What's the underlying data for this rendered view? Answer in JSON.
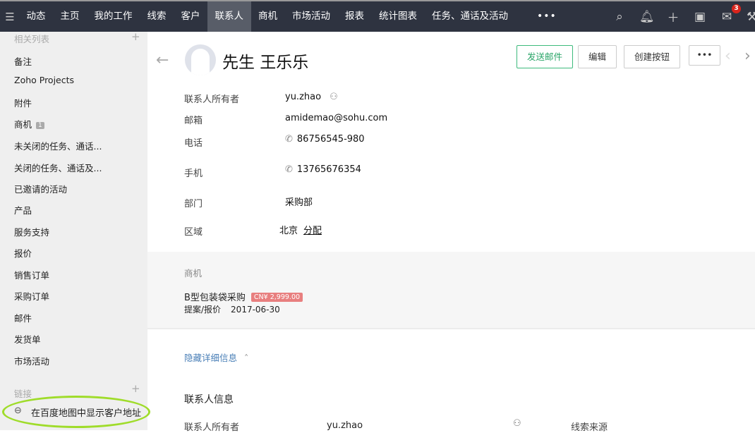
{
  "nav": {
    "items": [
      "动态",
      "主页",
      "我的工作",
      "线索",
      "客户",
      "联系人",
      "商机",
      "市场活动",
      "报表",
      "统计图表",
      "任务、通话及活动"
    ],
    "active": "联系人",
    "more": "•••",
    "mail_badge": "3"
  },
  "sidebar": {
    "related_header": "相关列表",
    "items": [
      "备注",
      "Zoho Projects",
      "附件",
      "商机",
      "未关闭的任务、通话...",
      "关闭的任务、通话及...",
      "已邀请的活动",
      "产品",
      "服务支持",
      "报价",
      "销售订单",
      "采购订单",
      "邮件",
      "发货单",
      "市场活动"
    ],
    "deal_count": "1",
    "links_header": "链接",
    "map_link": "在百度地图中显示客户地址"
  },
  "record": {
    "title": "先生 王乐乐",
    "buttons": {
      "send_email": "发送邮件",
      "edit": "编辑",
      "create_button": "创建按钮",
      "more": "•••"
    },
    "fields": [
      {
        "label": "联系人所有者",
        "value": "yu.zhao"
      },
      {
        "label": "邮箱",
        "value": "amidemao@sohu.com"
      },
      {
        "label": "电话",
        "value": "86756545-980"
      },
      {
        "label": "手机",
        "value": "13765676354"
      },
      {
        "label": "部门",
        "value": "采购部"
      },
      {
        "label": "区域",
        "value": "北京",
        "action": "分配"
      }
    ]
  },
  "deals": {
    "header": "商机",
    "name": "B型包装袋采购",
    "amount": "CN¥ 2,999.00",
    "stage": "提案/报价",
    "date": "2017-06-30"
  },
  "details": {
    "toggle": "隐藏详细信息",
    "section_title": "联系人信息",
    "owner_label": "联系人所有者",
    "owner_value": "yu.zhao",
    "source_label": "线索来源"
  }
}
